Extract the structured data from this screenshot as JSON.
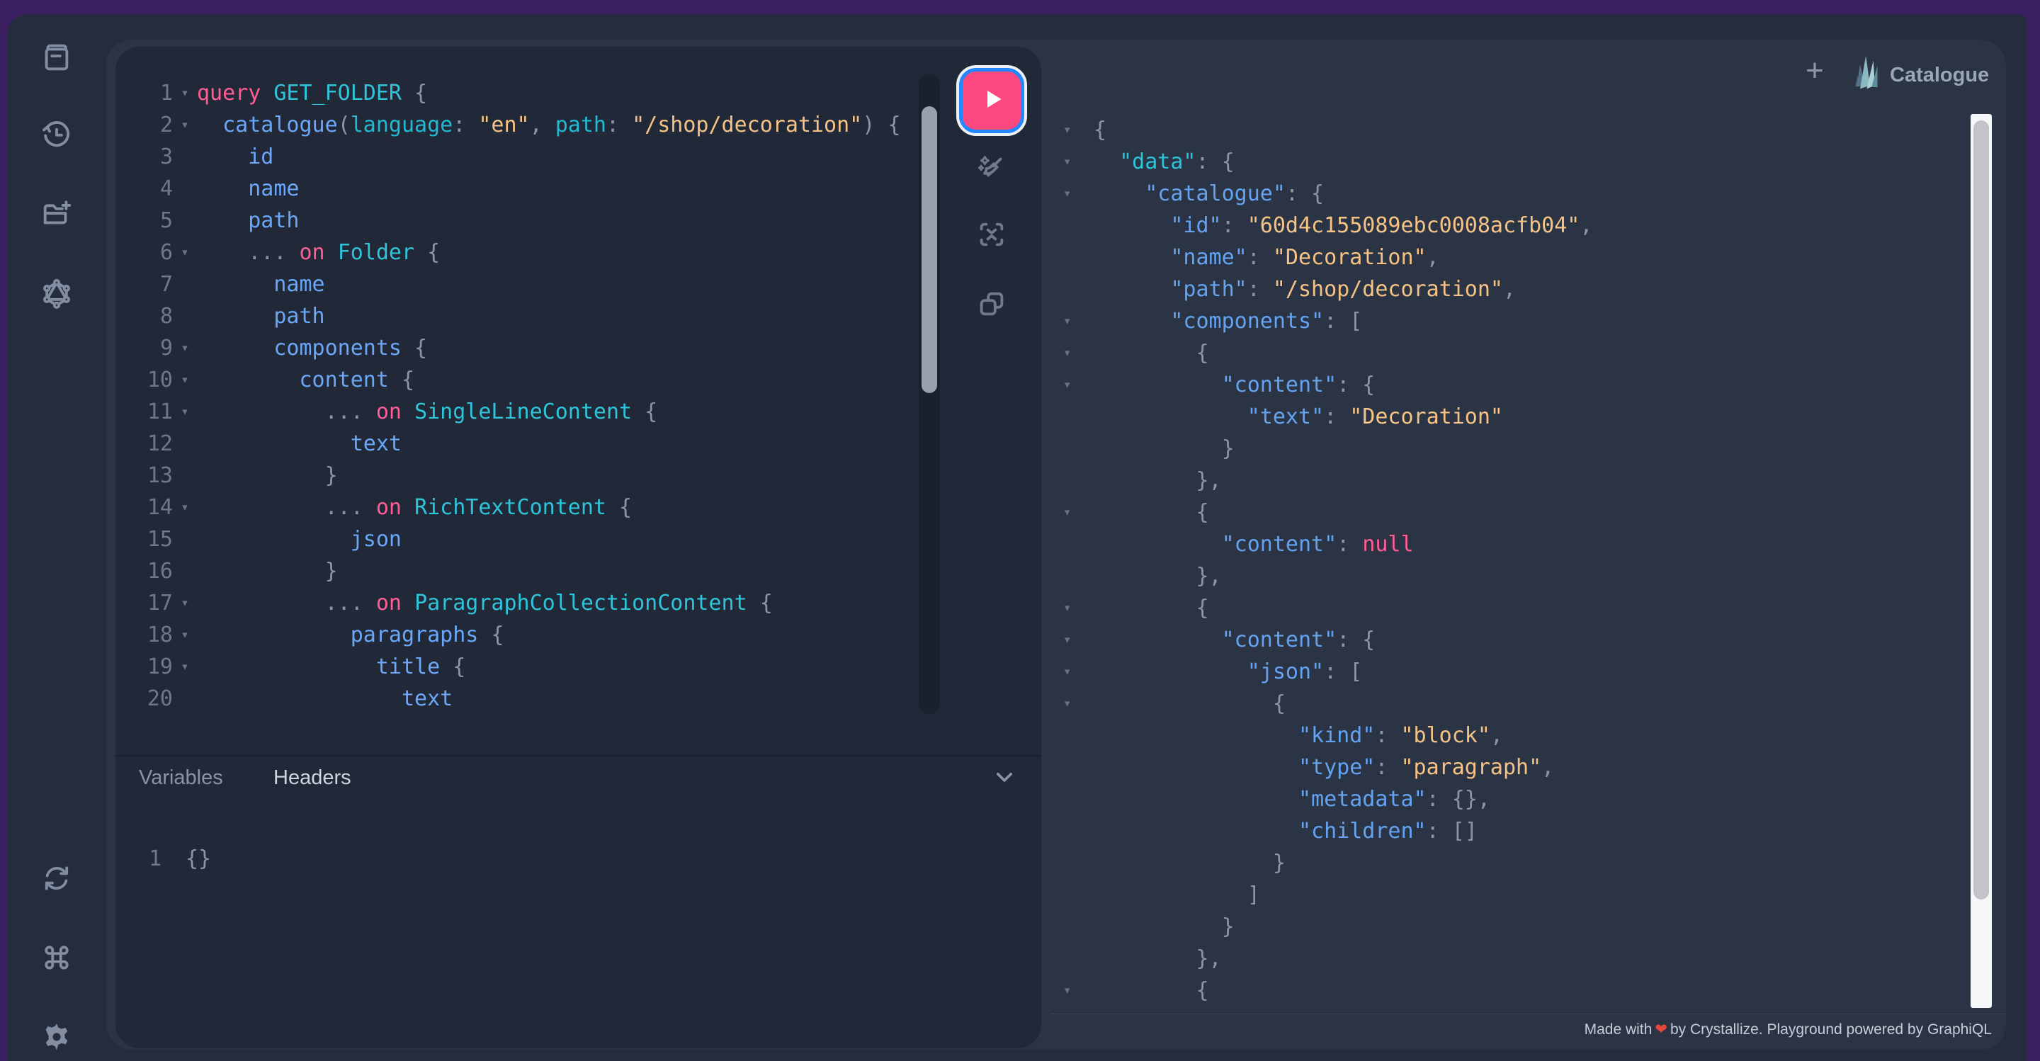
{
  "window": {
    "frame_color": "#3a2060",
    "app_background": "#242c3d",
    "session_background": "#2b3444",
    "editor_background": "#212837"
  },
  "header": {
    "plus_label": "+",
    "logo": "crystallize-logo",
    "app_name": "Catalogue"
  },
  "sidebar": {
    "top_icons": [
      {
        "name": "docs-icon",
        "label": "Documentation explorer"
      },
      {
        "name": "history-icon",
        "label": "History"
      },
      {
        "name": "new-folder-icon",
        "label": "New"
      },
      {
        "name": "graphql-schema-icon",
        "label": "Schema"
      }
    ],
    "bottom_icons": [
      {
        "name": "refetch-schema-icon",
        "label": "Re-fetch schema"
      },
      {
        "name": "keyboard-shortcuts-icon",
        "label": "Keyboard shortcuts"
      },
      {
        "name": "settings-icon",
        "label": "Settings"
      }
    ]
  },
  "toolbar": {
    "execute_icon": "execute-play-icon",
    "execute_color": "#fe4880",
    "execute_border_color": "#2388ff",
    "icons": [
      {
        "name": "prettify-icon",
        "label": "Prettify query"
      },
      {
        "name": "merge-fragments-icon",
        "label": "Merge fragments into query"
      },
      {
        "name": "copy-query-icon",
        "label": "Copy query"
      }
    ]
  },
  "query_editor": {
    "lines": [
      {
        "n": 1,
        "fold": true,
        "tokens": [
          [
            "kw",
            "query"
          ],
          [
            "pl",
            " "
          ],
          [
            "def",
            "GET_FOLDER"
          ],
          [
            "pun",
            " {"
          ]
        ]
      },
      {
        "n": 2,
        "fold": true,
        "tokens": [
          [
            "pl",
            "  "
          ],
          [
            "prop",
            "catalogue"
          ],
          [
            "pun",
            "("
          ],
          [
            "attr",
            "language"
          ],
          [
            "pun",
            ": "
          ],
          [
            "str",
            "\"en\""
          ],
          [
            "pun",
            ", "
          ],
          [
            "attr",
            "path"
          ],
          [
            "pun",
            ": "
          ],
          [
            "str",
            "\"/shop/decoration\""
          ],
          [
            "pun",
            ") {"
          ]
        ]
      },
      {
        "n": 3,
        "fold": false,
        "tokens": [
          [
            "pl",
            "    "
          ],
          [
            "prop",
            "id"
          ]
        ]
      },
      {
        "n": 4,
        "fold": false,
        "tokens": [
          [
            "pl",
            "    "
          ],
          [
            "prop",
            "name"
          ]
        ]
      },
      {
        "n": 5,
        "fold": false,
        "tokens": [
          [
            "pl",
            "    "
          ],
          [
            "prop",
            "path"
          ]
        ]
      },
      {
        "n": 6,
        "fold": true,
        "tokens": [
          [
            "pun",
            "    ... "
          ],
          [
            "kw",
            "on"
          ],
          [
            "pl",
            " "
          ],
          [
            "def",
            "Folder"
          ],
          [
            "pun",
            " {"
          ]
        ]
      },
      {
        "n": 7,
        "fold": false,
        "tokens": [
          [
            "pl",
            "      "
          ],
          [
            "prop",
            "name"
          ]
        ]
      },
      {
        "n": 8,
        "fold": false,
        "tokens": [
          [
            "pl",
            "      "
          ],
          [
            "prop",
            "path"
          ]
        ]
      },
      {
        "n": 9,
        "fold": true,
        "tokens": [
          [
            "pl",
            "      "
          ],
          [
            "prop",
            "components"
          ],
          [
            "pun",
            " {"
          ]
        ]
      },
      {
        "n": 10,
        "fold": true,
        "tokens": [
          [
            "pl",
            "        "
          ],
          [
            "prop",
            "content"
          ],
          [
            "pun",
            " {"
          ]
        ]
      },
      {
        "n": 11,
        "fold": true,
        "tokens": [
          [
            "pun",
            "          ... "
          ],
          [
            "kw",
            "on"
          ],
          [
            "pl",
            " "
          ],
          [
            "def",
            "SingleLineContent"
          ],
          [
            "pun",
            " {"
          ]
        ]
      },
      {
        "n": 12,
        "fold": false,
        "tokens": [
          [
            "pl",
            "            "
          ],
          [
            "prop",
            "text"
          ]
        ]
      },
      {
        "n": 13,
        "fold": false,
        "tokens": [
          [
            "pun",
            "          }"
          ]
        ]
      },
      {
        "n": 14,
        "fold": true,
        "tokens": [
          [
            "pun",
            "          ... "
          ],
          [
            "kw",
            "on"
          ],
          [
            "pl",
            " "
          ],
          [
            "def",
            "RichTextContent"
          ],
          [
            "pun",
            " {"
          ]
        ]
      },
      {
        "n": 15,
        "fold": false,
        "tokens": [
          [
            "pl",
            "            "
          ],
          [
            "prop",
            "json"
          ]
        ]
      },
      {
        "n": 16,
        "fold": false,
        "tokens": [
          [
            "pun",
            "          }"
          ]
        ]
      },
      {
        "n": 17,
        "fold": true,
        "tokens": [
          [
            "pun",
            "          ... "
          ],
          [
            "kw",
            "on"
          ],
          [
            "pl",
            " "
          ],
          [
            "def",
            "ParagraphCollectionContent"
          ],
          [
            "pun",
            " {"
          ]
        ]
      },
      {
        "n": 18,
        "fold": true,
        "tokens": [
          [
            "pl",
            "            "
          ],
          [
            "prop",
            "paragraphs"
          ],
          [
            "pun",
            " {"
          ]
        ]
      },
      {
        "n": 19,
        "fold": true,
        "tokens": [
          [
            "pl",
            "              "
          ],
          [
            "prop",
            "title"
          ],
          [
            "pun",
            " {"
          ]
        ]
      },
      {
        "n": 20,
        "fold": false,
        "tokens": [
          [
            "pl",
            "                "
          ],
          [
            "prop",
            "text"
          ]
        ]
      }
    ]
  },
  "secondary_editor": {
    "tabs": [
      {
        "label": "Variables",
        "active": false
      },
      {
        "label": "Headers",
        "active": true
      }
    ],
    "chevron_icon": "chevron-down-icon",
    "lines": [
      {
        "n": 1,
        "tokens": [
          [
            "pun",
            "{}"
          ]
        ]
      }
    ]
  },
  "result_viewer": {
    "lines": [
      {
        "fold": true,
        "tokens": [
          [
            "pun",
            "{"
          ]
        ]
      },
      {
        "fold": true,
        "tokens": [
          [
            "pl",
            "  "
          ],
          [
            "keyc",
            "\"data\""
          ],
          [
            "pun",
            ": {"
          ]
        ]
      },
      {
        "fold": true,
        "tokens": [
          [
            "pl",
            "    "
          ],
          [
            "key",
            "\"catalogue\""
          ],
          [
            "pun",
            ": {"
          ]
        ]
      },
      {
        "fold": false,
        "tokens": [
          [
            "pl",
            "      "
          ],
          [
            "key",
            "\"id\""
          ],
          [
            "pun",
            ": "
          ],
          [
            "str",
            "\"60d4c155089ebc0008acfb04\""
          ],
          [
            "pun",
            ","
          ]
        ]
      },
      {
        "fold": false,
        "tokens": [
          [
            "pl",
            "      "
          ],
          [
            "key",
            "\"name\""
          ],
          [
            "pun",
            ": "
          ],
          [
            "str",
            "\"Decoration\""
          ],
          [
            "pun",
            ","
          ]
        ]
      },
      {
        "fold": false,
        "tokens": [
          [
            "pl",
            "      "
          ],
          [
            "key",
            "\"path\""
          ],
          [
            "pun",
            ": "
          ],
          [
            "str",
            "\"/shop/decoration\""
          ],
          [
            "pun",
            ","
          ]
        ]
      },
      {
        "fold": true,
        "tokens": [
          [
            "pl",
            "      "
          ],
          [
            "key",
            "\"components\""
          ],
          [
            "pun",
            ": ["
          ]
        ]
      },
      {
        "fold": true,
        "tokens": [
          [
            "pl",
            "        "
          ],
          [
            "pun",
            "{"
          ]
        ]
      },
      {
        "fold": true,
        "tokens": [
          [
            "pl",
            "          "
          ],
          [
            "key",
            "\"content\""
          ],
          [
            "pun",
            ": {"
          ]
        ]
      },
      {
        "fold": false,
        "tokens": [
          [
            "pl",
            "            "
          ],
          [
            "key",
            "\"text\""
          ],
          [
            "pun",
            ": "
          ],
          [
            "str",
            "\"Decoration\""
          ]
        ]
      },
      {
        "fold": false,
        "tokens": [
          [
            "pun",
            "          }"
          ]
        ]
      },
      {
        "fold": false,
        "tokens": [
          [
            "pun",
            "        },"
          ]
        ]
      },
      {
        "fold": true,
        "tokens": [
          [
            "pl",
            "        "
          ],
          [
            "pun",
            "{"
          ]
        ]
      },
      {
        "fold": false,
        "tokens": [
          [
            "pl",
            "          "
          ],
          [
            "key",
            "\"content\""
          ],
          [
            "pun",
            ": "
          ],
          [
            "null",
            "null"
          ]
        ]
      },
      {
        "fold": false,
        "tokens": [
          [
            "pun",
            "        },"
          ]
        ]
      },
      {
        "fold": true,
        "tokens": [
          [
            "pl",
            "        "
          ],
          [
            "pun",
            "{"
          ]
        ]
      },
      {
        "fold": true,
        "tokens": [
          [
            "pl",
            "          "
          ],
          [
            "key",
            "\"content\""
          ],
          [
            "pun",
            ": {"
          ]
        ]
      },
      {
        "fold": true,
        "tokens": [
          [
            "pl",
            "            "
          ],
          [
            "key",
            "\"json\""
          ],
          [
            "pun",
            ": ["
          ]
        ]
      },
      {
        "fold": true,
        "tokens": [
          [
            "pl",
            "              "
          ],
          [
            "pun",
            "{"
          ]
        ]
      },
      {
        "fold": false,
        "tokens": [
          [
            "pl",
            "                "
          ],
          [
            "key",
            "\"kind\""
          ],
          [
            "pun",
            ": "
          ],
          [
            "str",
            "\"block\""
          ],
          [
            "pun",
            ","
          ]
        ]
      },
      {
        "fold": false,
        "tokens": [
          [
            "pl",
            "                "
          ],
          [
            "key",
            "\"type\""
          ],
          [
            "pun",
            ": "
          ],
          [
            "str",
            "\"paragraph\""
          ],
          [
            "pun",
            ","
          ]
        ]
      },
      {
        "fold": false,
        "tokens": [
          [
            "pl",
            "                "
          ],
          [
            "key",
            "\"metadata\""
          ],
          [
            "pun",
            ": {},"
          ]
        ]
      },
      {
        "fold": false,
        "tokens": [
          [
            "pl",
            "                "
          ],
          [
            "key",
            "\"children\""
          ],
          [
            "pun",
            ": []"
          ]
        ]
      },
      {
        "fold": false,
        "tokens": [
          [
            "pun",
            "              }"
          ]
        ]
      },
      {
        "fold": false,
        "tokens": [
          [
            "pun",
            "            ]"
          ]
        ]
      },
      {
        "fold": false,
        "tokens": [
          [
            "pun",
            "          }"
          ]
        ]
      },
      {
        "fold": false,
        "tokens": [
          [
            "pun",
            "        },"
          ]
        ]
      },
      {
        "fold": true,
        "tokens": [
          [
            "pl",
            "        "
          ],
          [
            "pun",
            "{"
          ]
        ]
      }
    ]
  },
  "footer": {
    "made_with": "Made with",
    "heart": "❤",
    "rest": "by Crystallize. Playground powered by GraphiQL"
  },
  "syntax_colors": {
    "keyword": "#ff5d94",
    "type": "#2ec4da",
    "field": "#6aa7f8",
    "argument": "#22bad2",
    "string": "#f6c386",
    "punctuation": "#8b95a7",
    "json_key": "#64a3f2",
    "json_data_key": "#2bc3da",
    "json_null": "#ff5d94"
  }
}
